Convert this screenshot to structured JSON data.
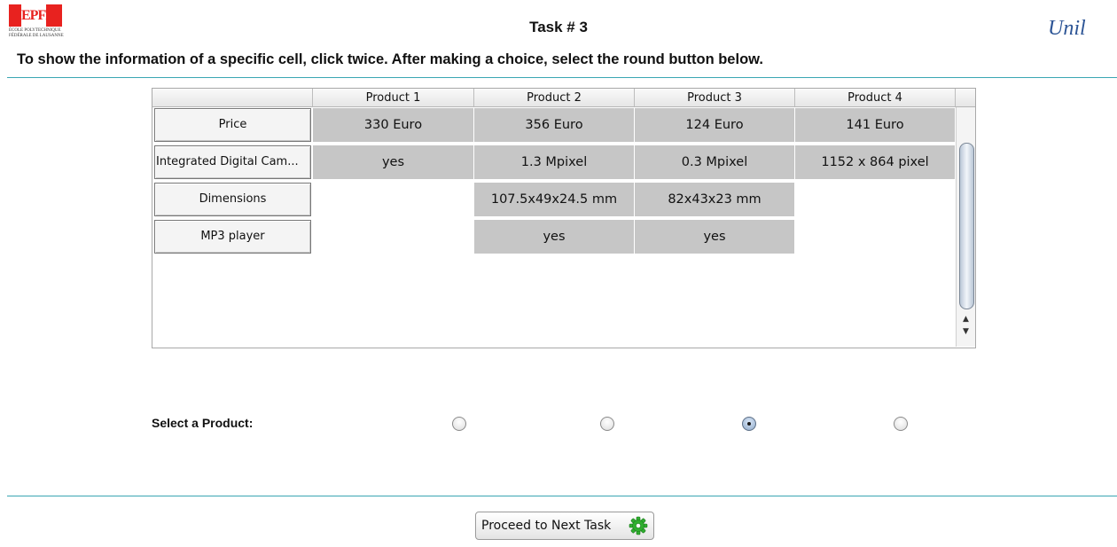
{
  "header": {
    "epfl_logo_word": "EPFL",
    "epfl_logo_subtext": "ÉCOLE POLYTECHNIQUE FÉDÉRALE DE LAUSANNE",
    "title": "Task # 3",
    "unil_logo_word": "Unil"
  },
  "instructions": "To show the information of a specific cell, click twice. After making a choice, select the round button below.",
  "table": {
    "columns": [
      "Product 1",
      "Product 2",
      "Product 3",
      "Product 4"
    ],
    "rows": [
      {
        "label": "Price",
        "cells": [
          "330 Euro",
          "356 Euro",
          "124 Euro",
          "141 Euro"
        ]
      },
      {
        "label": "Integrated Digital Cam...",
        "cells": [
          "yes",
          "1.3 Mpixel",
          "0.3 Mpixel",
          "1152 x 864 pixel"
        ]
      },
      {
        "label": "Dimensions",
        "cells": [
          "",
          "107.5x49x24.5 mm",
          "82x43x23 mm",
          ""
        ]
      },
      {
        "label": "MP3 player",
        "cells": [
          "",
          "yes",
          "yes",
          ""
        ]
      }
    ],
    "scroll_up_icon": "arrow-up-icon",
    "scroll_down_icon": "arrow-down-icon"
  },
  "selection": {
    "label": "Select a Product:",
    "selected_index": 2,
    "options_count": 4
  },
  "footer": {
    "next_button_label": "Proceed to Next Task",
    "next_button_icon": "gear-icon"
  },
  "colors": {
    "accent_rule": "#3aa6b3",
    "epfl_red": "#e8221f",
    "unil_blue": "#2d5596",
    "cell_gray": "#c6c6c6"
  }
}
